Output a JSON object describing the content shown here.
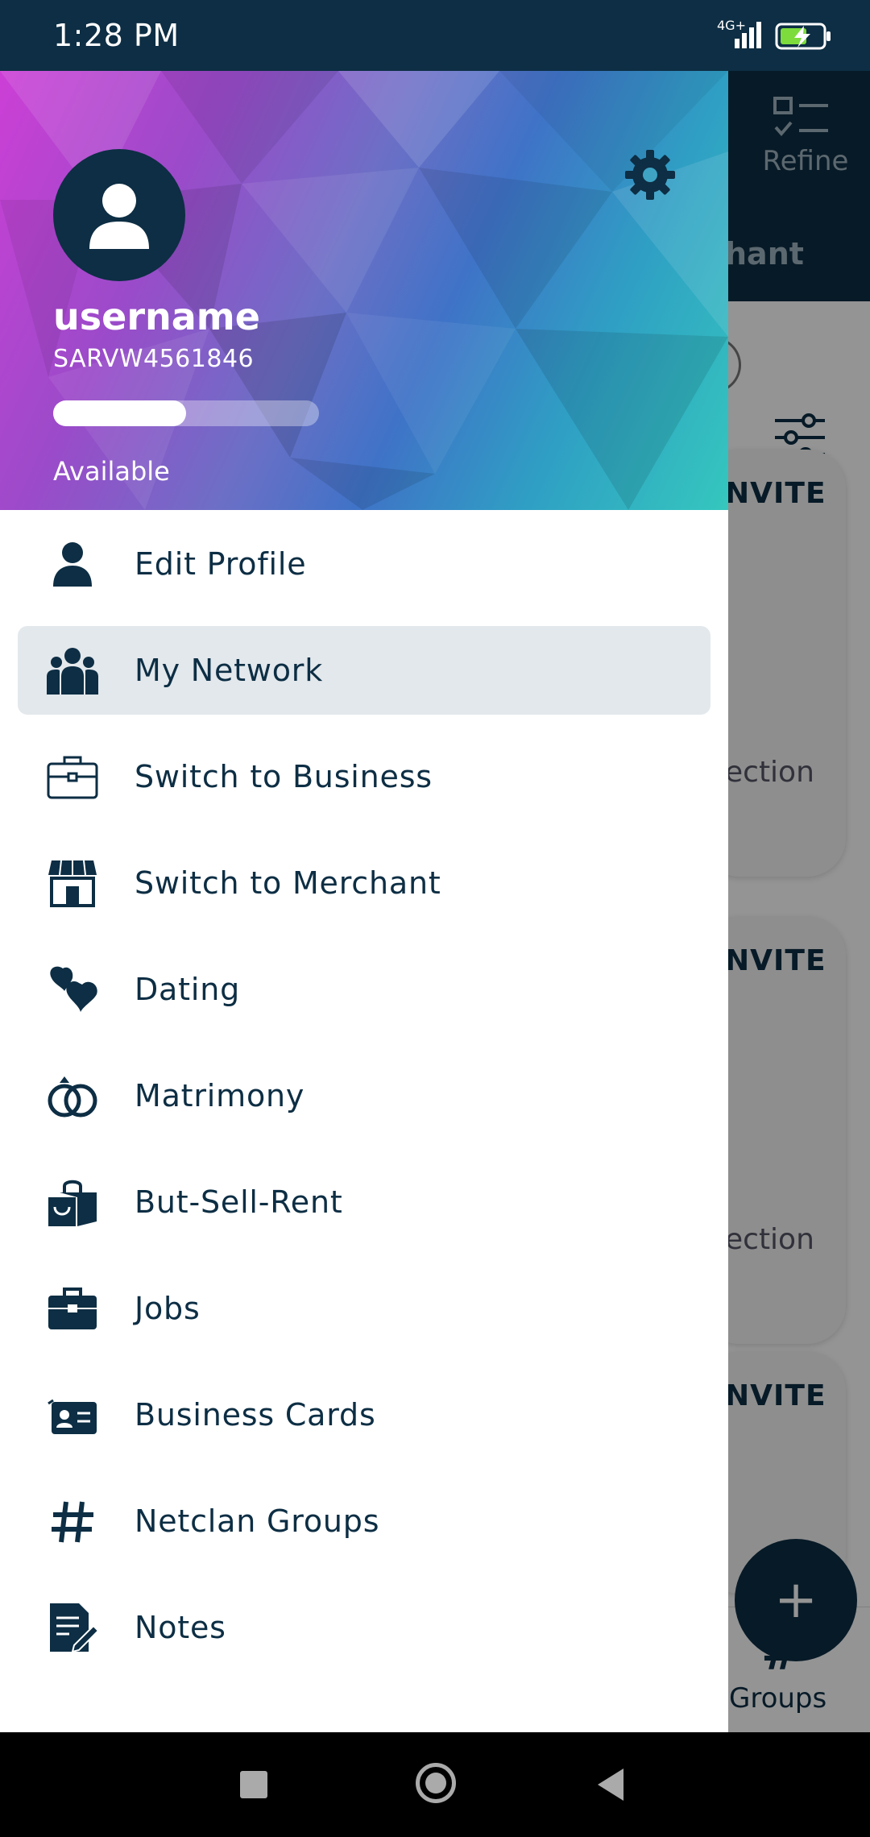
{
  "status_bar": {
    "time": "1:28 PM",
    "network": "4G+",
    "icons": [
      "signal-icon",
      "battery-charging-icon"
    ]
  },
  "background_app": {
    "refine_label": "Refine",
    "tab_partial": "hant",
    "card_labels": [
      "NVITE",
      "NVITE",
      "NVITE"
    ],
    "card_footers": [
      "ection",
      "ection"
    ],
    "fab_label": "+",
    "bottom_nav_label": "Groups",
    "bottom_nav_icon": "#"
  },
  "drawer": {
    "username": "username",
    "user_id": "SARVW4561846",
    "profile_completion": 0.5,
    "availability": "Available",
    "menu": [
      {
        "label": "Edit Profile",
        "icon": "person-icon",
        "active": false
      },
      {
        "label": "My Network",
        "icon": "people-icon",
        "active": true
      },
      {
        "label": "Switch to Business",
        "icon": "briefcase-outline-icon",
        "active": false
      },
      {
        "label": "Switch to Merchant",
        "icon": "store-icon",
        "active": false
      },
      {
        "label": "Dating",
        "icon": "hearts-icon",
        "active": false
      },
      {
        "label": "Matrimony",
        "icon": "rings-icon",
        "active": false
      },
      {
        "label": "But-Sell-Rent",
        "icon": "shopping-bag-icon",
        "active": false
      },
      {
        "label": "Jobs",
        "icon": "briefcase-icon",
        "active": false
      },
      {
        "label": "Business Cards",
        "icon": "id-card-icon",
        "active": false
      },
      {
        "label": "Netclan Groups",
        "icon": "hashtag-icon",
        "active": false
      },
      {
        "label": "Notes",
        "icon": "notes-icon",
        "active": false
      }
    ]
  },
  "colors": {
    "primary": "#0d2e44",
    "active_item_bg": "#e3e8ec"
  }
}
